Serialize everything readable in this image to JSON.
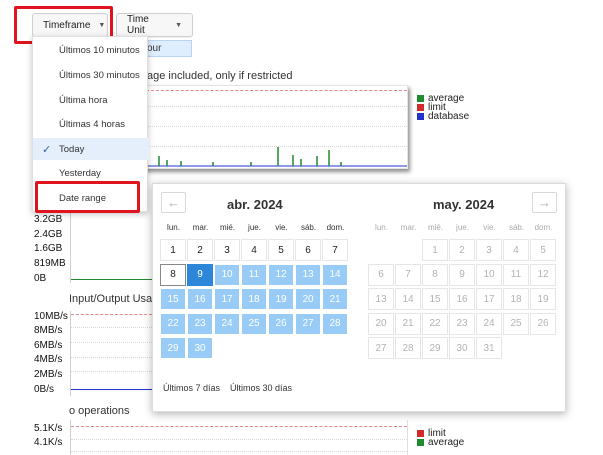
{
  "toolbar": {
    "timeframe_label": "Timeframe",
    "timeunit_label": "Time Unit",
    "hour_chip": "our"
  },
  "timeframe_menu": {
    "items": [
      {
        "label": "Últimos 10 minutos",
        "selected": false
      },
      {
        "label": "Últimos 30 minutos",
        "selected": false
      },
      {
        "label": "Última hora",
        "selected": false
      },
      {
        "label": "Últimas 4 horas",
        "selected": false
      },
      {
        "label": "Today",
        "selected": true
      },
      {
        "label": "Yesterday",
        "selected": false
      },
      {
        "label": "Date range",
        "selected": false
      }
    ]
  },
  "charts": {
    "chart1": {
      "title": "age included, only if restricted",
      "legend": [
        {
          "label": "average",
          "color": "#1f8a2e"
        },
        {
          "label": "limit",
          "color": "#d42a2a"
        },
        {
          "label": "database",
          "color": "#2233cc"
        }
      ]
    },
    "chart2": {
      "ylabels": [
        "3.2GB",
        "2.4GB",
        "1.6GB",
        "819MB",
        "0B"
      ]
    },
    "chart3": {
      "title": "Input/Output Usag",
      "ylabels": [
        "10MB/s",
        "8MB/s",
        "6MB/s",
        "4MB/s",
        "2MB/s",
        "0B/s"
      ]
    },
    "chart4": {
      "title": "o operations",
      "ylabels": [
        "5.1K/s",
        "4.1K/s"
      ],
      "legend": [
        {
          "label": "limit",
          "color": "#d42a2a"
        },
        {
          "label": "average",
          "color": "#1f8a2e"
        }
      ]
    }
  },
  "calendar": {
    "prev_icon": "arrow-left-icon",
    "next_icon": "arrow-right-icon",
    "weekdays": [
      "lun.",
      "mar.",
      "mié.",
      "jue.",
      "vie.",
      "sáb.",
      "dom."
    ],
    "april": {
      "title": "abr. 2024",
      "weeks": [
        [
          {
            "d": "1",
            "s": "norm"
          },
          {
            "d": "2",
            "s": "norm"
          },
          {
            "d": "3",
            "s": "norm"
          },
          {
            "d": "4",
            "s": "norm"
          },
          {
            "d": "5",
            "s": "norm"
          },
          {
            "d": "6",
            "s": "norm"
          },
          {
            "d": "7",
            "s": "norm"
          }
        ],
        [
          {
            "d": "8",
            "s": "today"
          },
          {
            "d": "9",
            "s": "start"
          },
          {
            "d": "10",
            "s": "range"
          },
          {
            "d": "11",
            "s": "range"
          },
          {
            "d": "12",
            "s": "range"
          },
          {
            "d": "13",
            "s": "range"
          },
          {
            "d": "14",
            "s": "range"
          }
        ],
        [
          {
            "d": "15",
            "s": "range"
          },
          {
            "d": "16",
            "s": "range"
          },
          {
            "d": "17",
            "s": "range"
          },
          {
            "d": "18",
            "s": "range"
          },
          {
            "d": "19",
            "s": "range"
          },
          {
            "d": "20",
            "s": "range"
          },
          {
            "d": "21",
            "s": "range"
          }
        ],
        [
          {
            "d": "22",
            "s": "range"
          },
          {
            "d": "23",
            "s": "range"
          },
          {
            "d": "24",
            "s": "range"
          },
          {
            "d": "25",
            "s": "range"
          },
          {
            "d": "26",
            "s": "range"
          },
          {
            "d": "27",
            "s": "range"
          },
          {
            "d": "28",
            "s": "range"
          }
        ],
        [
          {
            "d": "29",
            "s": "range"
          },
          {
            "d": "30",
            "s": "range"
          }
        ]
      ]
    },
    "may": {
      "title": "may. 2024",
      "weeks": [
        [
          {
            "d": "",
            "s": "none"
          },
          {
            "d": "",
            "s": "none"
          },
          {
            "d": "1",
            "s": "dis"
          },
          {
            "d": "2",
            "s": "dis"
          },
          {
            "d": "3",
            "s": "dis"
          },
          {
            "d": "4",
            "s": "dis"
          },
          {
            "d": "5",
            "s": "dis"
          }
        ],
        [
          {
            "d": "6",
            "s": "dis"
          },
          {
            "d": "7",
            "s": "dis"
          },
          {
            "d": "8",
            "s": "dis"
          },
          {
            "d": "9",
            "s": "dis"
          },
          {
            "d": "10",
            "s": "dis"
          },
          {
            "d": "11",
            "s": "dis"
          },
          {
            "d": "12",
            "s": "dis"
          }
        ],
        [
          {
            "d": "13",
            "s": "dis"
          },
          {
            "d": "14",
            "s": "dis"
          },
          {
            "d": "15",
            "s": "dis"
          },
          {
            "d": "16",
            "s": "dis"
          },
          {
            "d": "17",
            "s": "dis"
          },
          {
            "d": "18",
            "s": "dis"
          },
          {
            "d": "19",
            "s": "dis"
          }
        ],
        [
          {
            "d": "20",
            "s": "dis"
          },
          {
            "d": "21",
            "s": "dis"
          },
          {
            "d": "22",
            "s": "dis"
          },
          {
            "d": "23",
            "s": "dis"
          },
          {
            "d": "24",
            "s": "dis"
          },
          {
            "d": "25",
            "s": "dis"
          },
          {
            "d": "26",
            "s": "dis"
          }
        ],
        [
          {
            "d": "27",
            "s": "dis"
          },
          {
            "d": "28",
            "s": "dis"
          },
          {
            "d": "29",
            "s": "dis"
          },
          {
            "d": "30",
            "s": "dis"
          },
          {
            "d": "31",
            "s": "dis"
          }
        ]
      ]
    },
    "quick": [
      "Últimos 7 días",
      "Últimos 30 días"
    ]
  }
}
